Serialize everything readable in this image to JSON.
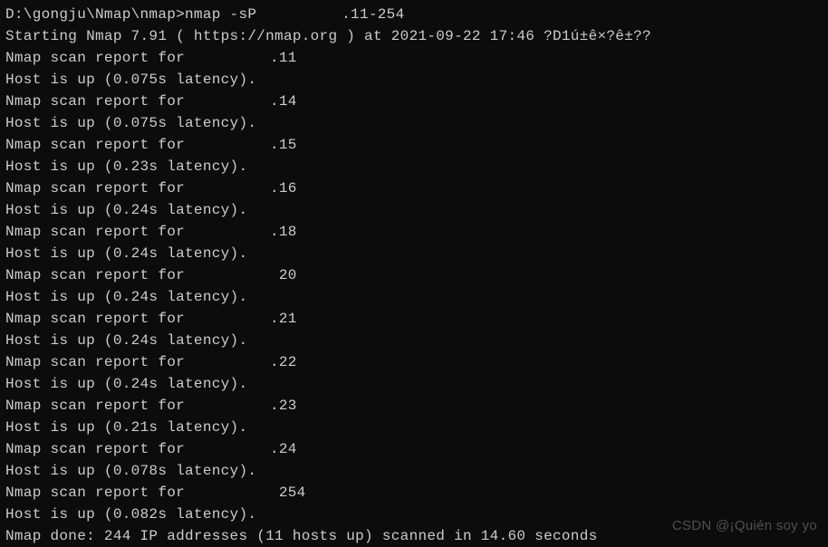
{
  "prompt": {
    "path": "D:\\gongju\\Nmap\\nmap>",
    "command": "nmap -sP ",
    "target_suffix": ".11-254"
  },
  "start_line": "Starting Nmap 7.91 ( https://nmap.org ) at 2021-09-22 17:46 ?D1ú±ê×?ê±??",
  "hosts": [
    {
      "ip_suffix": ".11",
      "latency": "0.075s"
    },
    {
      "ip_suffix": ".14",
      "latency": "0.075s"
    },
    {
      "ip_suffix": ".15",
      "latency": "0.23s"
    },
    {
      "ip_suffix": ".16",
      "latency": "0.24s"
    },
    {
      "ip_suffix": ".18",
      "latency": "0.24s"
    },
    {
      "ip_suffix": " 20",
      "latency": "0.24s"
    },
    {
      "ip_suffix": ".21",
      "latency": "0.24s"
    },
    {
      "ip_suffix": ".22",
      "latency": "0.24s"
    },
    {
      "ip_suffix": ".23",
      "latency": "0.21s"
    },
    {
      "ip_suffix": ".24",
      "latency": "0.078s"
    },
    {
      "ip_suffix": " 254",
      "latency": "0.082s"
    }
  ],
  "report_prefix": "Nmap scan report for ",
  "status_prefix": "Host is up (",
  "status_suffix": " latency).",
  "done_line": "Nmap done: 244 IP addresses (11 hosts up) scanned in 14.60 seconds",
  "watermark": "CSDN @¡Quién soy yo"
}
